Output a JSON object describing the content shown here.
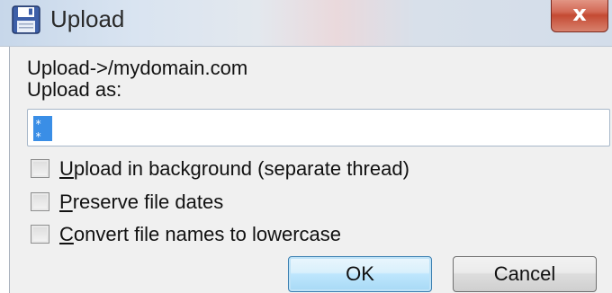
{
  "window": {
    "title": "Upload",
    "close_label": "x"
  },
  "dialog": {
    "path_label": "Upload->/mydomain.com",
    "upload_as_label": "Upload as:",
    "name_input_value": "",
    "options": [
      {
        "label": "Upload in background (separate thread)",
        "accel": "U",
        "rest": "pload in background (separate thread)",
        "checked": false
      },
      {
        "label": "Preserve file dates",
        "accel": "P",
        "rest": "reserve file dates",
        "checked": false
      },
      {
        "label": "Convert file names to lowercase",
        "accel": "C",
        "rest": "onvert file names to lowercase",
        "checked": false
      }
    ],
    "ok_label": "OK",
    "cancel_label": "Cancel"
  },
  "icons": {
    "title_icon": "floppy-disk-icon",
    "close_icon": "close-icon"
  },
  "colors": {
    "selection": "#3a8ee6",
    "close_button": "#c44a33",
    "client_background": "#f0f0f0"
  }
}
